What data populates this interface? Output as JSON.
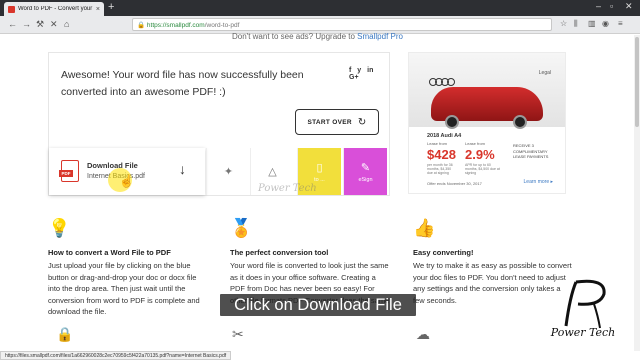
{
  "browser": {
    "tab_title": "Word to PDF - Convert your Do",
    "tab_close": "×",
    "new_tab": "+",
    "url_domain": "https://smallpdf.com",
    "url_path": "/word-to-pdf",
    "status_url": "https://files.smallpdf.com/files/1a662960028c2ec70959c5f422a70135.pdf?name=Internet Basics.pdf"
  },
  "upgrade_banner": {
    "text": "Don't want to see ads? Upgrade to",
    "link": "Smallpdf Pro"
  },
  "result": {
    "message": "Awesome! Your word file has now successfully been converted into an awesome PDF! :)",
    "social": [
      "f",
      "y",
      "in",
      "G+"
    ],
    "start_over_label": "START OVER",
    "download_title": "Download File",
    "file_name": "Internet Basics.pdf",
    "pdf_tag": "PDF",
    "service_word_label": "to ...",
    "esign_label": "eSign"
  },
  "ad": {
    "legal": "Legal",
    "year_model": "2018 Audi A4",
    "lease_label": "Lease from",
    "price": "$428",
    "price_note": "per month for 36 months, $4,350 due at signing",
    "apr_label": "Lease from",
    "apr": "2.9%",
    "apr_note": "APR for up to 60 months, $4,500 due at signing",
    "receive": "RECEIVE 3 COMPLIMENTARY LEASE PAYMENTS",
    "offer_end": "Offer ends November 30, 2017",
    "learn_more": "Learn more ▸"
  },
  "features": [
    {
      "title": "How to convert a Word File to PDF",
      "text": "Just upload your file by clicking on the blue button or drag-and-drop your doc or docx file into the drop area. Then just wait until the conversion from word to PDF is complete and download the file."
    },
    {
      "title": "The perfect conversion tool",
      "text": "Your word file is converted to look just the same as it does in your office software. Creating a PDF from Doc has never been so easy! For other file formats PDF Converter does the same"
    },
    {
      "title": "Easy converting!",
      "text": "We try to make it as easy as possible to convert your doc files to PDF. You don't need to adjust any settings and the conversion only takes a few seconds."
    }
  ],
  "overlay": {
    "caption": "Click on Download File",
    "watermark": "Power Tech",
    "logo_text": "Power Tech"
  },
  "colors": {
    "accent_red": "#d9362b",
    "yellow_tile": "#f2df3b",
    "pink_tile": "#d94fd9"
  }
}
